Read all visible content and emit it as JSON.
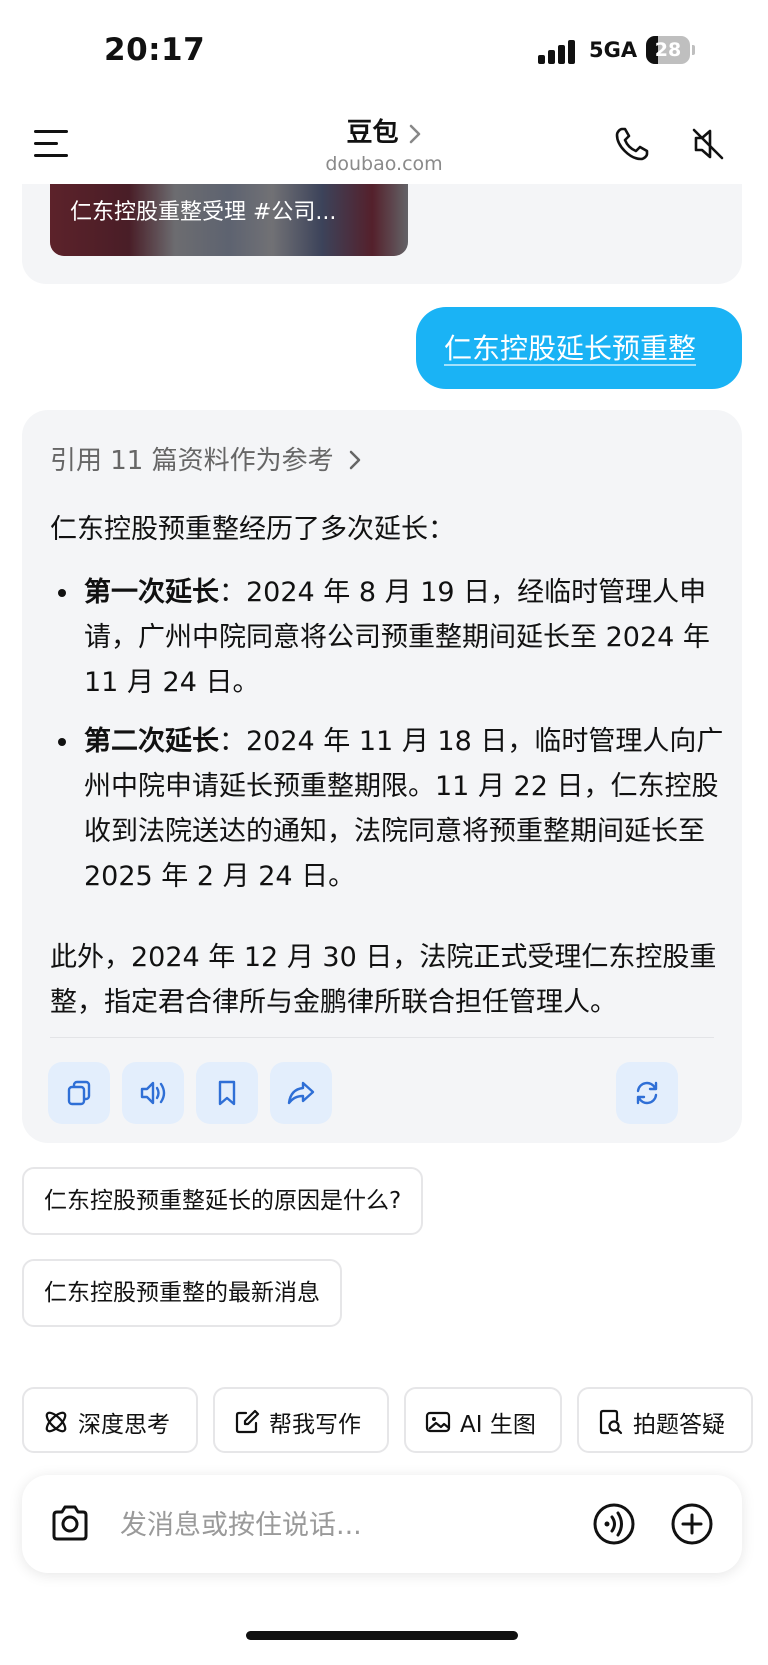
{
  "status_bar": {
    "time": "20:17",
    "network": "5GA",
    "battery": "28",
    "battery_level": 0.28
  },
  "header": {
    "title": "豆包",
    "subtitle": "doubao.com"
  },
  "previous_message": {
    "card_caption": "仁东控股重整受理 #公司..."
  },
  "user_message": {
    "text": "仁东控股延长预重整"
  },
  "ai_reply": {
    "references": "引用 11 篇资料作为参考",
    "intro": "仁东控股预重整经历了多次延长：",
    "bullets": [
      {
        "title": "第一次延长",
        "text": "：2024 年 8 月 19 日，经临时管理人申请，广州中院同意将公司预重整期间延长至 2024 年 11 月 24 日。"
      },
      {
        "title": "第二次延长",
        "text": "：2024 年 11 月 18 日，临时管理人向广州中院申请延长预重整期限。11 月 22 日，仁东控股收到法院送达的通知，法院同意将预重整期间延长至 2025 年 2 月 24 日。"
      }
    ],
    "outro": "此外，2024 年 12 月 30 日，法院正式受理仁东控股重整，指定君合律所与金鹏律所联合担任管理人。",
    "actions": [
      {
        "icon": "copy-icon"
      },
      {
        "icon": "speaker-icon"
      },
      {
        "icon": "bookmark-icon"
      },
      {
        "icon": "share-icon"
      },
      {
        "icon": "regenerate-icon"
      }
    ]
  },
  "suggestions": [
    "仁东控股预重整延长的原因是什么?",
    "仁东控股预重整的最新消息"
  ],
  "tools": [
    {
      "label": "深度思考",
      "icon": "atom-icon"
    },
    {
      "label": "帮我写作",
      "icon": "pen-icon"
    },
    {
      "label": "AI 生图",
      "icon": "image-icon"
    },
    {
      "label": "拍题答疑",
      "icon": "search-doc-icon"
    }
  ],
  "input": {
    "placeholder": "发消息或按住说话..."
  },
  "colors": {
    "accent": "#1ab3f5",
    "card_bg": "#f4f5f7",
    "action_bg": "#e3eefc",
    "action_icon": "#2f6fd6"
  }
}
